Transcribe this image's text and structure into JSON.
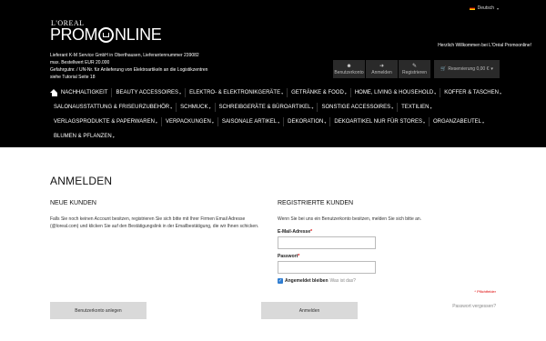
{
  "header": {
    "language": "Deutsch",
    "logo_top": "L'OREAL",
    "logo_left": "PROM",
    "logo_right": "NLINE",
    "info_lines": [
      "Lieferant K-M Service GmbH in Oberthausen, Lieferantennummer 239082",
      "max. Bestellwert EUR 20.000",
      "Gefahrgutnr. / UN-Nr. für Anlieferung von Elektroartikeln an die Logistikzentren",
      "siehe Tutorial Seite 18"
    ],
    "welcome": "Herzlich Willkommen bei L'Oréal Promoonline!",
    "tools": [
      {
        "icon": "user-icon",
        "label": "Benutzerkonto"
      },
      {
        "icon": "login-icon",
        "label": "Anmelden"
      },
      {
        "icon": "register-icon",
        "label": "Registrieren"
      }
    ],
    "cart_label": "Reservierung  0,00 €",
    "cart_caret": "▾"
  },
  "nav": {
    "rows": [
      [
        {
          "label": "NACHHALTIGKEIT",
          "chev": false
        },
        {
          "label": "BEAUTY ACCESSOIRES",
          "chev": true
        },
        {
          "label": "ELEKTRO- & ELEKTRONIKGERÄTE",
          "chev": true
        },
        {
          "label": "GETRÄNKE & FOOD",
          "chev": true
        },
        {
          "label": "HOME, LIVING & HOUSEHOLD",
          "chev": true
        },
        {
          "label": "KOFFER & TASCHEN",
          "chev": true
        }
      ],
      [
        {
          "label": "SALONAUSSTATTUNG & FRISEURZUBEHÖR",
          "chev": true
        },
        {
          "label": "SCHMUCK",
          "chev": true
        },
        {
          "label": "SCHREIBGERÄTE & BÜROARTIKEL",
          "chev": true
        },
        {
          "label": "SONSTIGE ACCESSOIRES",
          "chev": true
        },
        {
          "label": "TEXTILIEN",
          "chev": true
        }
      ],
      [
        {
          "label": "VERLAGSPRODUKTE & PAPERWAREN",
          "chev": true
        },
        {
          "label": "VERPACKUNGEN",
          "chev": true
        },
        {
          "label": "SAISONALE ARTIKEL",
          "chev": true
        },
        {
          "label": "DEKORATION",
          "chev": true
        },
        {
          "label": "DEKOARTIKEL NUR FÜR STORES",
          "chev": true
        },
        {
          "label": "ORGANZABEUTEL",
          "chev": true
        }
      ],
      [
        {
          "label": "BLUMEN & PFLANZEN",
          "chev": true
        }
      ]
    ]
  },
  "main": {
    "title": "ANMELDEN",
    "new_customers": {
      "heading": "NEUE KUNDEN",
      "text": "Falls Sie noch keinen Account besitzen, registrieren Sie sich bitte mit Ihrer Firmen Email Adresse (@loreal.com) und klicken Sie auf den Bestätigungslink in der Emailbestätigung, die wir Ihnen schicken.",
      "button": "Benutzerkonto anlegen"
    },
    "registered": {
      "heading": "REGISTRIERTE KUNDEN",
      "text": "Wenn Sie bei uns ein Benutzerkonto besitzen, melden Sie sich bitte an.",
      "email_label": "E-Mail-Adresse",
      "password_label": "Passwort",
      "required_mark": "*",
      "email_value": "",
      "password_value": "",
      "remember_label": "Angemeldet bleiben",
      "remember_help": "Was ist das?",
      "required_note": "* Pflichtfelder",
      "button": "Anmelden",
      "forgot": "Passwort vergessen?"
    }
  }
}
